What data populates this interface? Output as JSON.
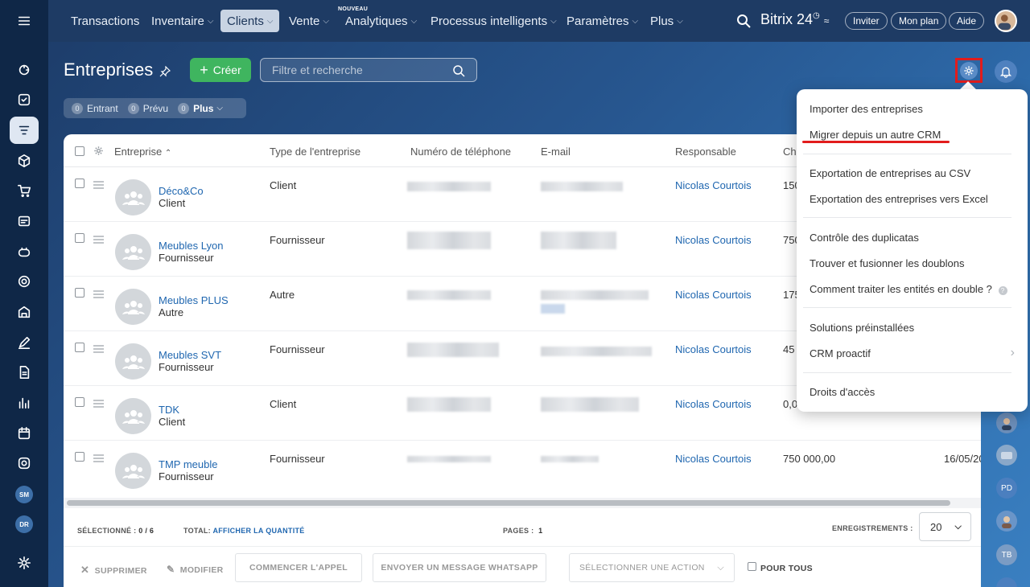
{
  "nav": {
    "items": [
      "Transactions",
      "Inventaire",
      "Clients",
      "Vente",
      "Analytiques",
      "Processus intelligents",
      "Paramètres",
      "Plus"
    ],
    "new_badge": "NOUVEAU",
    "brand": "Bitrix 24",
    "invite": "Inviter",
    "my_plan": "Mon plan",
    "help": "Aide"
  },
  "page": {
    "title": "Entreprises",
    "create": "Créer",
    "filter_placeholder": "Filtre et recherche"
  },
  "counters": {
    "incoming_num": "0",
    "incoming": "Entrant",
    "planned_num": "0",
    "planned": "Prévu",
    "more_num": "0",
    "more": "Plus"
  },
  "table": {
    "headers": [
      "Entreprise",
      "Type de l'entreprise",
      "Numéro de téléphone",
      "E-mail",
      "Responsable",
      "Ch"
    ],
    "rows": [
      {
        "name": "Déco&Co",
        "subtype": "Client",
        "type": "Client",
        "resp": "Nicolas Courtois",
        "ch": "150"
      },
      {
        "name": "Meubles Lyon",
        "subtype": "Fournisseur",
        "type": "Fournisseur",
        "resp": "Nicolas Courtois",
        "ch": "750"
      },
      {
        "name": "Meubles PLUS",
        "subtype": "Autre",
        "type": "Autre",
        "resp": "Nicolas Courtois",
        "ch": "175"
      },
      {
        "name": "Meubles SVT",
        "subtype": "Fournisseur",
        "type": "Fournisseur",
        "resp": "Nicolas Courtois",
        "ch": "45"
      },
      {
        "name": "TDK",
        "subtype": "Client",
        "type": "Client",
        "resp": "Nicolas Courtois",
        "ch": "0,0"
      },
      {
        "name": "TMP meuble",
        "subtype": "Fournisseur",
        "type": "Fournisseur",
        "resp": "Nicolas Courtois",
        "ch": "750 000,00",
        "date": "16/05/20"
      }
    ]
  },
  "footer": {
    "selected_label": "SÉLECTIONNÉ :",
    "selected_value": "0 / 6",
    "total_label": "TOTAL:",
    "total_link": "AFFICHER LA QUANTITÉ",
    "pages_label": "PAGES :",
    "pages_value": "1",
    "records_label": "ENREGISTREMENTS :",
    "records_value": "20"
  },
  "actions": {
    "delete": "SUPPRIMER",
    "edit": "MODIFIER",
    "call": "COMMENCER L'APPEL",
    "whatsapp": "ENVOYER UN MESSAGE WHATSAPP",
    "select_action": "SÉLECTIONNER UNE ACTION",
    "for_all": "POUR TOUS"
  },
  "menu": {
    "items": [
      "Importer des entreprises",
      "Migrer depuis un autre CRM",
      "Exportation de entreprises au CSV",
      "Exportation des entreprises vers Excel",
      "Contrôle des duplicatas",
      "Trouver et fusionner les doublons",
      "Comment traiter les entités en double ?",
      "Solutions préinstallées",
      "CRM proactif",
      "Droits d'accès"
    ]
  },
  "sidebar": {
    "badges": [
      "SM",
      "DR"
    ]
  },
  "right_strip": {
    "badges": [
      "PD",
      "TB"
    ]
  },
  "colors": {
    "accent_green": "#3fb55f",
    "link_blue": "#2067b0",
    "highlight_red": "#e21c1c"
  }
}
